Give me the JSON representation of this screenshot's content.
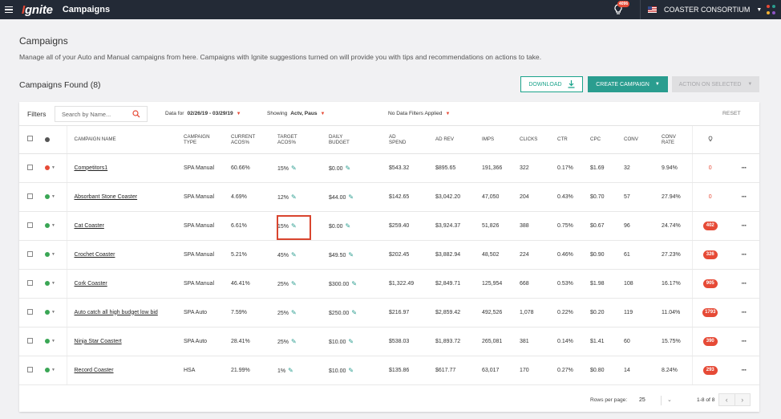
{
  "topbar": {
    "logo_prefix": "I",
    "logo_rest": "gnite",
    "title": "Campaigns",
    "bulb_badge": "4096",
    "account_name": "COASTER CONSORTIUM",
    "grid_colors": [
      "#e64a36",
      "#2a9d8f",
      "#f2b134",
      "#8c54c5"
    ]
  },
  "header": {
    "title": "Campaigns",
    "description": "Manage all of your Auto and Manual campaigns from here. Campaigns with Ignite suggestions turned on will provide you with tips and recommendations on actions to take.",
    "found_label": "Campaigns Found (8)",
    "download_label": "DOWNLOAD",
    "create_label": "CREATE CAMPAIGN",
    "action_label": "ACTION ON SELECTED"
  },
  "filters": {
    "label": "Filters",
    "search_placeholder": "Search by Name...",
    "data_for_prefix": "Data for",
    "date_range": "02/26/19 - 03/29/19",
    "showing_prefix": "Showing",
    "showing_value": "Actv, Paus",
    "data_filters": "No Data Filters Applied",
    "reset_label": "RESET"
  },
  "columns": {
    "name": "CAMPAIGN NAME",
    "type_1": "CAMPAIGN",
    "type_2": "TYPE",
    "cacos_1": "CURRENT",
    "cacos_2": "ACOS%",
    "tacos_1": "TARGET",
    "tacos_2": "ACOS%",
    "budget_1": "DAILY",
    "budget_2": "BUDGET",
    "spend_1": "AD",
    "spend_2": "SPEND",
    "rev": "AD REV",
    "imps": "IMPS",
    "clicks": "CLICKS",
    "ctr": "CTR",
    "cpc": "CPC",
    "conv": "CONV",
    "rate_1": "CONV",
    "rate_2": "RATE"
  },
  "rows": [
    {
      "status": "#e64a36",
      "name": "Competitors1",
      "type": "SPA Manual",
      "cacos": "60.66%",
      "tacos": "15%",
      "budget": "$0.00",
      "spend": "$543.32",
      "rev": "$895.65",
      "imps": "191,366",
      "clicks": "322",
      "ctr": "0.17%",
      "cpc": "$1.69",
      "conv": "32",
      "rate": "9.94%",
      "sugg": "0",
      "sugg_pill": false
    },
    {
      "status": "#3aa655",
      "name": "Absorbant Stone Coaster",
      "type": "SPA Manual",
      "cacos": "4.69%",
      "tacos": "12%",
      "budget": "$44.00",
      "spend": "$142.65",
      "rev": "$3,042.20",
      "imps": "47,050",
      "clicks": "204",
      "ctr": "0.43%",
      "cpc": "$0.70",
      "conv": "57",
      "rate": "27.94%",
      "sugg": "0",
      "sugg_pill": false
    },
    {
      "status": "#3aa655",
      "name": "Cat Coaster",
      "type": "SPA Manual",
      "cacos": "6.61%",
      "tacos": "15%",
      "budget": "$0.00",
      "spend": "$259.40",
      "rev": "$3,924.37",
      "imps": "51,826",
      "clicks": "388",
      "ctr": "0.75%",
      "cpc": "$0.67",
      "conv": "96",
      "rate": "24.74%",
      "sugg": "402",
      "sugg_pill": true
    },
    {
      "status": "#3aa655",
      "name": "Crochet Coaster",
      "type": "SPA Manual",
      "cacos": "5.21%",
      "tacos": "45%",
      "budget": "$49.50",
      "spend": "$202.45",
      "rev": "$3,882.94",
      "imps": "48,502",
      "clicks": "224",
      "ctr": "0.46%",
      "cpc": "$0.90",
      "conv": "61",
      "rate": "27.23%",
      "sugg": "326",
      "sugg_pill": true
    },
    {
      "status": "#3aa655",
      "name": "Cork Coaster",
      "type": "SPA Manual",
      "cacos": "46.41%",
      "tacos": "25%",
      "budget": "$300.00",
      "spend": "$1,322.49",
      "rev": "$2,849.71",
      "imps": "125,954",
      "clicks": "668",
      "ctr": "0.53%",
      "cpc": "$1.98",
      "conv": "108",
      "rate": "16.17%",
      "sugg": "905",
      "sugg_pill": true
    },
    {
      "status": "#3aa655",
      "name": "Auto catch all high budget low bid",
      "type": "SPA Auto",
      "cacos": "7.59%",
      "tacos": "25%",
      "budget": "$250.00",
      "spend": "$216.97",
      "rev": "$2,859.42",
      "imps": "492,526",
      "clicks": "1,078",
      "ctr": "0.22%",
      "cpc": "$0.20",
      "conv": "119",
      "rate": "11.04%",
      "sugg": "1793",
      "sugg_pill": true
    },
    {
      "status": "#3aa655",
      "name": "Ninja Star Coastert",
      "type": "SPA Auto",
      "cacos": "28.41%",
      "tacos": "25%",
      "budget": "$10.00",
      "spend": "$538.03",
      "rev": "$1,893.72",
      "imps": "265,081",
      "clicks": "381",
      "ctr": "0.14%",
      "cpc": "$1.41",
      "conv": "60",
      "rate": "15.75%",
      "sugg": "390",
      "sugg_pill": true
    },
    {
      "status": "#3aa655",
      "name": "Record Coaster",
      "type": "HSA",
      "cacos": "21.99%",
      "tacos": "1%",
      "budget": "$10.00",
      "spend": "$135.86",
      "rev": "$617.77",
      "imps": "63,017",
      "clicks": "170",
      "ctr": "0.27%",
      "cpc": "$0.80",
      "conv": "14",
      "rate": "8.24%",
      "sugg": "293",
      "sugg_pill": true
    }
  ],
  "footer": {
    "rows_per_page_label": "Rows per page:",
    "rows_per_page_value": "25",
    "range": "1-8 of 8"
  }
}
